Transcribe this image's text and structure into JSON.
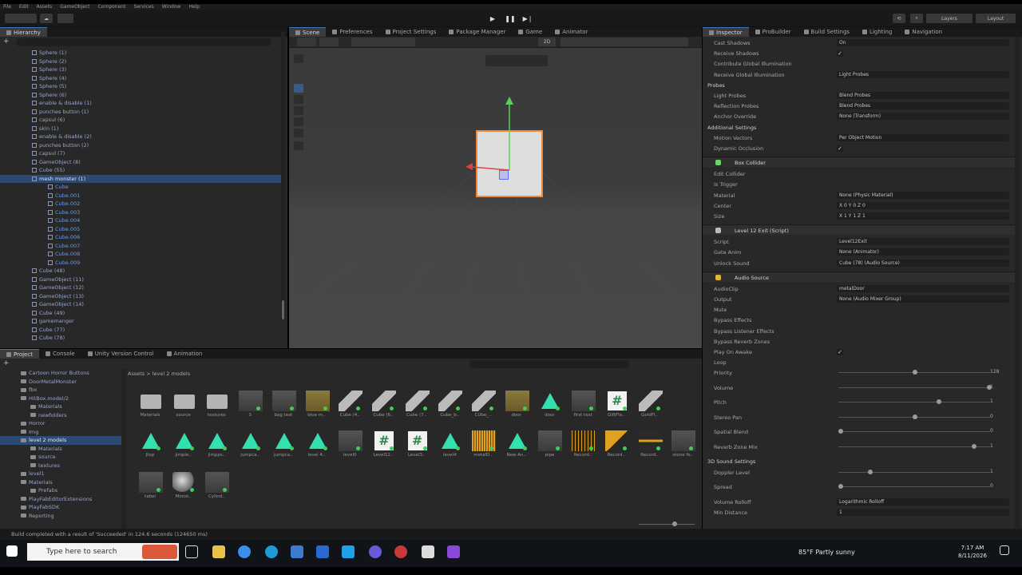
{
  "menu": [
    "File",
    "Edit",
    "Assets",
    "GameObject",
    "Component",
    "Services",
    "Window",
    "Help"
  ],
  "toolbar": {
    "layers": "Layers",
    "layout": "Layout"
  },
  "hierarchy": {
    "tab": "Hierarchy",
    "items": [
      {
        "label": "Sphere (1)",
        "depth": 1
      },
      {
        "label": "Sphere (2)",
        "depth": 1
      },
      {
        "label": "Sphere (3)",
        "depth": 1
      },
      {
        "label": "Sphere (4)",
        "depth": 1
      },
      {
        "label": "Sphere (5)",
        "depth": 1
      },
      {
        "label": "Sphere (6)",
        "depth": 1
      },
      {
        "label": "enable & disable (1)",
        "depth": 1
      },
      {
        "label": "punches button (1)",
        "depth": 1
      },
      {
        "label": "capsul (6)",
        "depth": 1
      },
      {
        "label": "skin (1)",
        "depth": 1
      },
      {
        "label": "enable & disable (2)",
        "depth": 1
      },
      {
        "label": "punches button (2)",
        "depth": 1
      },
      {
        "label": "capsul (7)",
        "depth": 1
      },
      {
        "label": "GameObject (8)",
        "depth": 1
      },
      {
        "label": "Cube (55)",
        "depth": 1
      },
      {
        "label": "mesh monster (1)",
        "depth": 1,
        "selected": true
      },
      {
        "label": "Cube",
        "depth": 2
      },
      {
        "label": "Cube.001",
        "depth": 2
      },
      {
        "label": "Cube.002",
        "depth": 2
      },
      {
        "label": "Cube.003",
        "depth": 2
      },
      {
        "label": "Cube.004",
        "depth": 2
      },
      {
        "label": "Cube.005",
        "depth": 2
      },
      {
        "label": "Cube.006",
        "depth": 2
      },
      {
        "label": "Cube.007",
        "depth": 2
      },
      {
        "label": "Cube.008",
        "depth": 2
      },
      {
        "label": "Cube.009",
        "depth": 2
      },
      {
        "label": "Cube (48)",
        "depth": 1
      },
      {
        "label": "GameObject (11)",
        "depth": 1
      },
      {
        "label": "GameObject (12)",
        "depth": 1
      },
      {
        "label": "GameObject (13)",
        "depth": 1
      },
      {
        "label": "GameObject (14)",
        "depth": 1
      },
      {
        "label": "Cube (49)",
        "depth": 1
      },
      {
        "label": "gamemanger",
        "depth": 1
      },
      {
        "label": "Cube (77)",
        "depth": 1
      },
      {
        "label": "Cube (78)",
        "depth": 1
      }
    ]
  },
  "scene_tabs": [
    {
      "label": "Scene",
      "active": true
    },
    {
      "label": "Preferences"
    },
    {
      "label": "Project Settings"
    },
    {
      "label": "Package Manager"
    },
    {
      "label": "Game"
    },
    {
      "label": "Animator"
    }
  ],
  "scene_mode": "2D",
  "inspector": {
    "tabs": [
      "Inspector",
      "ProBuilder",
      "Build Settings",
      "Lighting",
      "Navigation"
    ],
    "rows": [
      {
        "type": "row",
        "label": "Cast Shadows",
        "value": "On"
      },
      {
        "type": "row",
        "label": "Receive Shadows",
        "check": true
      },
      {
        "type": "row",
        "label": "Contribute Global Illumination"
      },
      {
        "type": "row",
        "label": "Receive Global Illumination",
        "value": "Light Probes"
      },
      {
        "type": "section",
        "label": "Probes"
      },
      {
        "type": "row",
        "label": "Light Probes",
        "value": "Blend Probes"
      },
      {
        "type": "row",
        "label": "Reflection Probes",
        "value": "Blend Probes"
      },
      {
        "type": "row",
        "label": "Anchor Override",
        "value": "None (Transform)"
      },
      {
        "type": "section",
        "label": "Additional Settings"
      },
      {
        "type": "row",
        "label": "Motion Vectors",
        "value": "Per Object Motion"
      },
      {
        "type": "row",
        "label": "Dynamic Occlusion",
        "check": true
      },
      {
        "type": "component",
        "label": "Box Collider",
        "color": "#6ad36a"
      },
      {
        "type": "row",
        "label": "Edit Collider"
      },
      {
        "type": "row",
        "label": "Is Trigger"
      },
      {
        "type": "row",
        "label": "Material",
        "value": "None (Physic Material)"
      },
      {
        "type": "row",
        "label": "Center",
        "value": "X 0      Y 0      Z 0"
      },
      {
        "type": "row",
        "label": "Size",
        "value": "X 1      Y 1      Z 1"
      },
      {
        "type": "component",
        "label": "Level 12 Exit (Script)",
        "color": "#bcbcbc"
      },
      {
        "type": "row",
        "label": "Script",
        "value": "Level12Exit"
      },
      {
        "type": "row",
        "label": "Gate Anim",
        "value": "None (Animator)"
      },
      {
        "type": "row",
        "label": "Unlock Sound",
        "value": "Cube (78) (Audio Source)"
      },
      {
        "type": "component",
        "label": "Audio Source",
        "color": "#e0b43a"
      },
      {
        "type": "row",
        "label": "AudioClip",
        "value": "metalDoor"
      },
      {
        "type": "row",
        "label": "Output",
        "value": "None (Audio Mixer Group)"
      },
      {
        "type": "row",
        "label": "Mute"
      },
      {
        "type": "row",
        "label": "Bypass Effects"
      },
      {
        "type": "row",
        "label": "Bypass Listener Effects"
      },
      {
        "type": "row",
        "label": "Bypass Reverb Zones"
      },
      {
        "type": "row",
        "label": "Play On Awake",
        "check": true
      },
      {
        "type": "row",
        "label": "Loop"
      },
      {
        "type": "slider",
        "label": "Priority",
        "pct": 0.5,
        "num": "128"
      },
      {
        "type": "slider",
        "label": "Volume",
        "pct": 1.0,
        "num": "1"
      },
      {
        "type": "slider",
        "label": "Pitch",
        "pct": 0.66,
        "num": "1"
      },
      {
        "type": "slider",
        "label": "Stereo Pan",
        "pct": 0.5,
        "num": "0"
      },
      {
        "type": "slider",
        "label": "Spatial Blend",
        "pct": 0.0,
        "num": "0"
      },
      {
        "type": "slider",
        "label": "Reverb Zone Mix",
        "pct": 0.9,
        "num": "1"
      },
      {
        "type": "section",
        "label": "3D Sound Settings"
      },
      {
        "type": "slider",
        "label": "Doppler Level",
        "pct": 0.2,
        "num": "1"
      },
      {
        "type": "slider",
        "label": "Spread",
        "pct": 0.0,
        "num": "0"
      },
      {
        "type": "row",
        "label": "Volume Rolloff",
        "value": "Logarithmic Rolloff"
      },
      {
        "type": "row",
        "label": "Min Distance",
        "value": "1"
      }
    ]
  },
  "project": {
    "tabs": [
      "Project",
      "Console",
      "Unity Version Control",
      "Animation"
    ],
    "breadcrumb": "Assets > level 2 models",
    "tree": [
      {
        "label": "Cartoon Horror Buttons",
        "depth": 1
      },
      {
        "label": "DoorMetalMonster",
        "depth": 1
      },
      {
        "label": "fbx",
        "depth": 1
      },
      {
        "label": "HitBox.model/2",
        "depth": 1
      },
      {
        "label": "Materials",
        "depth": 2
      },
      {
        "label": "newfolders",
        "depth": 2
      },
      {
        "label": "Horror",
        "depth": 1
      },
      {
        "label": "Img",
        "depth": 1
      },
      {
        "label": "level 2 models",
        "depth": 1,
        "selected": true
      },
      {
        "label": "Materials",
        "depth": 2
      },
      {
        "label": "source",
        "depth": 2
      },
      {
        "label": "textures",
        "depth": 2
      },
      {
        "label": "level1",
        "depth": 1
      },
      {
        "label": "Materials",
        "depth": 1
      },
      {
        "label": "Prefabs",
        "depth": 2
      },
      {
        "label": "PlayFabEditorExtensions",
        "depth": 1
      },
      {
        "label": "PlayFabSDK",
        "depth": 1
      },
      {
        "label": "Reporting",
        "depth": 1
      }
    ],
    "assets_row1": [
      {
        "label": "Materials",
        "kind": "folder"
      },
      {
        "label": "source",
        "kind": "folder"
      },
      {
        "label": "textures",
        "kind": "folder"
      },
      {
        "label": "3",
        "kind": "model"
      },
      {
        "label": "bag test",
        "kind": "model"
      },
      {
        "label": "blue m..",
        "kind": "tex"
      },
      {
        "label": "Cube (4..",
        "kind": "prefab"
      },
      {
        "label": "Cube (6..",
        "kind": "prefab"
      },
      {
        "label": "Cube (7..",
        "kind": "prefab"
      },
      {
        "label": "Cube_b..",
        "kind": "prefab"
      },
      {
        "label": "CUbe_..",
        "kind": "prefab"
      },
      {
        "label": "door",
        "kind": "tex"
      },
      {
        "label": "door",
        "kind": "tri"
      },
      {
        "label": "first test",
        "kind": "model"
      },
      {
        "label": "GiftFlo..",
        "kind": "hash"
      },
      {
        "label": "GoldFl..",
        "kind": "prefab"
      }
    ],
    "assets_row2": [
      {
        "label": "Jtop",
        "kind": "tri"
      },
      {
        "label": "jimple..",
        "kind": "tri"
      },
      {
        "label": "jimpps..",
        "kind": "tri"
      },
      {
        "label": "jumpca..",
        "kind": "tri"
      },
      {
        "label": "jumpca..",
        "kind": "tri"
      },
      {
        "label": "level 4..",
        "kind": "tri"
      },
      {
        "label": "level0",
        "kind": "model"
      },
      {
        "label": "Level12..",
        "kind": "hash"
      },
      {
        "label": "Level3..",
        "kind": "hash"
      },
      {
        "label": "level4",
        "kind": "tri"
      },
      {
        "label": "metalD..",
        "kind": "audio"
      },
      {
        "label": "New An..",
        "kind": "tri"
      },
      {
        "label": "pipe",
        "kind": "model"
      },
      {
        "label": "Record..",
        "kind": "audio2"
      },
      {
        "label": "Record..",
        "kind": "play"
      },
      {
        "label": "Record..",
        "kind": "play2"
      },
      {
        "label": "stone fo..",
        "kind": "model"
      }
    ],
    "assets_row3": [
      {
        "label": "tabel",
        "kind": "model"
      },
      {
        "label": "Monst..",
        "kind": "sphere"
      },
      {
        "label": "Cylind..",
        "kind": "model"
      }
    ]
  },
  "status": "Build completed with a result of 'Succeeded' in 124.6 seconds (124650 ms)",
  "taskbar": {
    "search_placeholder": "Type here to search",
    "weather": "85°F Partly sunny",
    "time": "7:17 AM",
    "date": "8/11/2026"
  }
}
